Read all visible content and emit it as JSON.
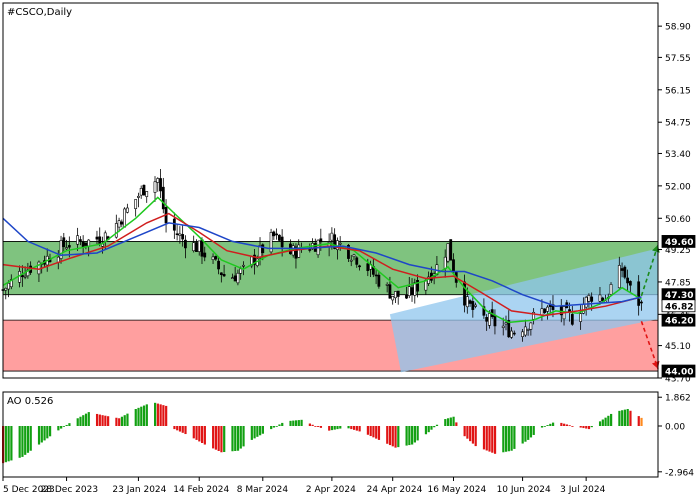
{
  "window": {
    "title": "#CSCO,Daily"
  },
  "colors": {
    "axis": "#000000",
    "green_zone": "#7fc37f",
    "red_zone": "#ff9f9f",
    "channel": "#8fc6ee",
    "bull_candle_border": "#000000",
    "ma_green": "#1ec81e",
    "ma_red": "#d01e1e",
    "ma_blue": "#1e46c8",
    "ao_up": "#12a012",
    "ao_down": "#e01414",
    "ao_last": "#ff8a1e",
    "arrow_up": "#1a8a1a",
    "arrow_down": "#e01414",
    "label_dark": "#000000",
    "label_light": "#ffffff"
  },
  "chart_data": [
    {
      "type": "candlestick",
      "title": "#CSCO,Daily",
      "ylim": [
        43.7,
        59.9
      ],
      "y_ticks": [
        "58.90",
        "57.55",
        "56.15",
        "54.75",
        "53.40",
        "52.00",
        "50.60",
        "49.25",
        "47.85",
        "46.45",
        "45.10",
        "43.70"
      ],
      "y_tick_values": [
        58.9,
        57.55,
        56.15,
        54.75,
        53.4,
        52.0,
        50.6,
        49.25,
        47.85,
        46.45,
        45.1,
        43.7
      ],
      "x_ticks": [
        "5 Dec 2023",
        "28 Dec 2023",
        "23 Jan 2024",
        "14 Feb 2024",
        "8 Mar 2024",
        "2 Apr 2024",
        "24 Apr 2024",
        "16 May 2024",
        "10 Jun 2024",
        "3 Jul 2024"
      ],
      "x_tick_dates": [
        "2023-12-05",
        "2023-12-28",
        "2024-01-23",
        "2024-02-14",
        "2024-03-08",
        "2024-04-02",
        "2024-04-24",
        "2024-05-16",
        "2024-06-10",
        "2024-07-03"
      ],
      "x_range": [
        "2023-12-05",
        "2024-07-29"
      ],
      "price_labels": [
        {
          "text": "49.60",
          "value": 49.6,
          "style": "dark"
        },
        {
          "text": "47.30",
          "value": 47.3,
          "style": "dark"
        },
        {
          "text": "46.82",
          "value": 46.82,
          "style": "light"
        },
        {
          "text": "46.20",
          "value": 46.2,
          "style": "dark"
        },
        {
          "text": "44.00",
          "value": 44.0,
          "style": "dark"
        }
      ],
      "zones": [
        {
          "name": "green",
          "from": 47.3,
          "to": 49.6,
          "x_from": "2023-12-05",
          "x_to": "2024-07-29"
        },
        {
          "name": "red",
          "from": 44.0,
          "to": 46.2,
          "x_from": "2023-12-05",
          "x_to": "2024-07-29"
        }
      ],
      "channel": {
        "upper": [
          [
            "2024-04-23",
            46.45
          ],
          [
            "2024-07-29",
            49.3
          ]
        ],
        "lower": [
          [
            "2024-04-27",
            43.95
          ],
          [
            "2024-07-29",
            46.25
          ]
        ]
      },
      "arrows": [
        {
          "direction": "up",
          "from": [
            "2024-07-23",
            47.25
          ],
          "to": [
            "2024-07-29",
            49.45
          ]
        },
        {
          "direction": "down",
          "from": [
            "2024-07-23",
            46.15
          ],
          "to": [
            "2024-07-29",
            44.1
          ]
        }
      ],
      "close_path": [
        [
          "2023-12-05",
          47.5
        ],
        [
          "2023-12-12",
          48.3
        ],
        [
          "2023-12-20",
          48.8
        ],
        [
          "2023-12-28",
          49.5
        ],
        [
          "2024-01-05",
          49.6
        ],
        [
          "2024-01-12",
          49.9
        ],
        [
          "2024-01-18",
          50.8
        ],
        [
          "2024-01-25",
          51.9
        ],
        [
          "2024-01-30",
          52.3
        ],
        [
          "2024-02-02",
          50.4
        ],
        [
          "2024-02-08",
          49.7
        ],
        [
          "2024-02-14",
          49.3
        ],
        [
          "2024-02-19",
          48.7
        ],
        [
          "2024-02-24",
          48.0
        ],
        [
          "2024-03-01",
          48.3
        ],
        [
          "2024-03-06",
          49.0
        ],
        [
          "2024-03-12",
          49.8
        ],
        [
          "2024-03-18",
          49.1
        ],
        [
          "2024-03-25",
          49.4
        ],
        [
          "2024-04-01",
          49.8
        ],
        [
          "2024-04-08",
          49.2
        ],
        [
          "2024-04-14",
          48.6
        ],
        [
          "2024-04-20",
          47.8
        ],
        [
          "2024-04-24",
          47.3
        ],
        [
          "2024-04-29",
          47.2
        ],
        [
          "2024-05-04",
          47.8
        ],
        [
          "2024-05-10",
          48.5
        ],
        [
          "2024-05-14",
          49.4
        ],
        [
          "2024-05-17",
          48.0
        ],
        [
          "2024-05-21",
          46.9
        ],
        [
          "2024-05-25",
          46.4
        ],
        [
          "2024-06-01",
          46.0
        ],
        [
          "2024-06-07",
          45.7
        ],
        [
          "2024-06-12",
          46.1
        ],
        [
          "2024-06-18",
          46.7
        ],
        [
          "2024-06-24",
          46.5
        ],
        [
          "2024-06-28",
          46.3
        ],
        [
          "2024-07-02",
          46.9
        ],
        [
          "2024-07-06",
          47.4
        ],
        [
          "2024-07-10",
          47.1
        ],
        [
          "2024-07-13",
          47.9
        ],
        [
          "2024-07-16",
          48.4
        ],
        [
          "2024-07-19",
          47.5
        ],
        [
          "2024-07-23",
          46.82
        ]
      ],
      "moving_averages": [
        {
          "color_key": "ma_green",
          "points": [
            [
              "2023-12-05",
              47.7
            ],
            [
              "2023-12-15",
              48.4
            ],
            [
              "2023-12-28",
              49.2
            ],
            [
              "2024-01-10",
              49.5
            ],
            [
              "2024-01-22",
              50.6
            ],
            [
              "2024-01-30",
              51.5
            ],
            [
              "2024-02-06",
              50.7
            ],
            [
              "2024-02-14",
              49.8
            ],
            [
              "2024-02-22",
              48.8
            ],
            [
              "2024-03-01",
              48.4
            ],
            [
              "2024-03-10",
              49.0
            ],
            [
              "2024-03-20",
              49.3
            ],
            [
              "2024-04-01",
              49.5
            ],
            [
              "2024-04-10",
              49.2
            ],
            [
              "2024-04-18",
              48.4
            ],
            [
              "2024-04-26",
              47.6
            ],
            [
              "2024-05-06",
              47.9
            ],
            [
              "2024-05-14",
              48.5
            ],
            [
              "2024-05-20",
              47.6
            ],
            [
              "2024-05-28",
              46.6
            ],
            [
              "2024-06-05",
              46.1
            ],
            [
              "2024-06-14",
              46.2
            ],
            [
              "2024-06-22",
              46.6
            ],
            [
              "2024-06-30",
              46.5
            ],
            [
              "2024-07-08",
              46.9
            ],
            [
              "2024-07-16",
              47.6
            ],
            [
              "2024-07-23",
              47.1
            ]
          ]
        },
        {
          "color_key": "ma_red",
          "points": [
            [
              "2023-12-05",
              48.6
            ],
            [
              "2023-12-18",
              48.4
            ],
            [
              "2023-12-30",
              48.9
            ],
            [
              "2024-01-12",
              49.4
            ],
            [
              "2024-01-26",
              50.4
            ],
            [
              "2024-02-03",
              50.8
            ],
            [
              "2024-02-14",
              50.0
            ],
            [
              "2024-02-24",
              49.2
            ],
            [
              "2024-03-06",
              48.9
            ],
            [
              "2024-03-18",
              49.2
            ],
            [
              "2024-04-01",
              49.4
            ],
            [
              "2024-04-12",
              49.2
            ],
            [
              "2024-04-24",
              48.4
            ],
            [
              "2024-05-06",
              48.0
            ],
            [
              "2024-05-16",
              48.1
            ],
            [
              "2024-05-26",
              47.4
            ],
            [
              "2024-06-06",
              46.6
            ],
            [
              "2024-06-18",
              46.4
            ],
            [
              "2024-06-30",
              46.6
            ],
            [
              "2024-07-10",
              46.8
            ],
            [
              "2024-07-23",
              47.2
            ]
          ]
        },
        {
          "color_key": "ma_blue",
          "points": [
            [
              "2023-12-05",
              50.6
            ],
            [
              "2023-12-14",
              49.6
            ],
            [
              "2023-12-26",
              49.0
            ],
            [
              "2024-01-08",
              49.1
            ],
            [
              "2024-01-22",
              49.8
            ],
            [
              "2024-02-03",
              50.4
            ],
            [
              "2024-02-14",
              50.2
            ],
            [
              "2024-02-26",
              49.6
            ],
            [
              "2024-03-10",
              49.3
            ],
            [
              "2024-03-24",
              49.3
            ],
            [
              "2024-04-06",
              49.4
            ],
            [
              "2024-04-18",
              49.1
            ],
            [
              "2024-04-30",
              48.6
            ],
            [
              "2024-05-12",
              48.3
            ],
            [
              "2024-05-20",
              48.3
            ],
            [
              "2024-05-30",
              47.9
            ],
            [
              "2024-06-10",
              47.3
            ],
            [
              "2024-06-22",
              46.8
            ],
            [
              "2024-07-04",
              46.9
            ],
            [
              "2024-07-16",
              47.0
            ],
            [
              "2024-07-23",
              47.2
            ]
          ]
        }
      ]
    },
    {
      "type": "bar",
      "title": "AO 0.526",
      "ylim": [
        -3.3,
        2.2
      ],
      "y_ticks": [
        "1.862",
        "0.00",
        "-2.964"
      ],
      "y_tick_values": [
        1.862,
        0.0,
        -2.964
      ],
      "x_range": [
        "2023-12-05",
        "2024-07-29"
      ],
      "last_value": 0.526,
      "profile": [
        [
          "2023-12-05",
          -2.4
        ],
        [
          "2023-12-12",
          -2.0
        ],
        [
          "2023-12-18",
          -1.2
        ],
        [
          "2023-12-24",
          -0.4
        ],
        [
          "2023-12-30",
          0.3
        ],
        [
          "2024-01-05",
          0.9
        ],
        [
          "2024-01-10",
          0.7
        ],
        [
          "2024-01-16",
          0.5
        ],
        [
          "2024-01-22",
          1.1
        ],
        [
          "2024-01-28",
          1.55
        ],
        [
          "2024-02-02",
          1.3
        ],
        [
          "2024-02-05",
          -0.2
        ],
        [
          "2024-02-10",
          -0.6
        ],
        [
          "2024-02-16",
          -1.2
        ],
        [
          "2024-02-22",
          -1.7
        ],
        [
          "2024-02-28",
          -1.6
        ],
        [
          "2024-03-04",
          -0.9
        ],
        [
          "2024-03-10",
          -0.3
        ],
        [
          "2024-03-16",
          0.3
        ],
        [
          "2024-03-22",
          0.4
        ],
        [
          "2024-03-27",
          0.0
        ],
        [
          "2024-04-01",
          -0.3
        ],
        [
          "2024-04-07",
          -0.1
        ],
        [
          "2024-04-13",
          -0.4
        ],
        [
          "2024-04-19",
          -0.9
        ],
        [
          "2024-04-25",
          -1.4
        ],
        [
          "2024-05-01",
          -1.2
        ],
        [
          "2024-05-07",
          -0.4
        ],
        [
          "2024-05-12",
          0.4
        ],
        [
          "2024-05-16",
          0.6
        ],
        [
          "2024-05-19",
          -0.5
        ],
        [
          "2024-05-24",
          -1.3
        ],
        [
          "2024-05-31",
          -1.8
        ],
        [
          "2024-06-06",
          -1.6
        ],
        [
          "2024-06-12",
          -0.9
        ],
        [
          "2024-06-17",
          -0.1
        ],
        [
          "2024-06-22",
          0.3
        ],
        [
          "2024-06-28",
          0.0
        ],
        [
          "2024-07-04",
          -0.2
        ],
        [
          "2024-07-08",
          0.3
        ],
        [
          "2024-07-13",
          0.9
        ],
        [
          "2024-07-18",
          1.1
        ],
        [
          "2024-07-23",
          0.526
        ]
      ]
    }
  ]
}
